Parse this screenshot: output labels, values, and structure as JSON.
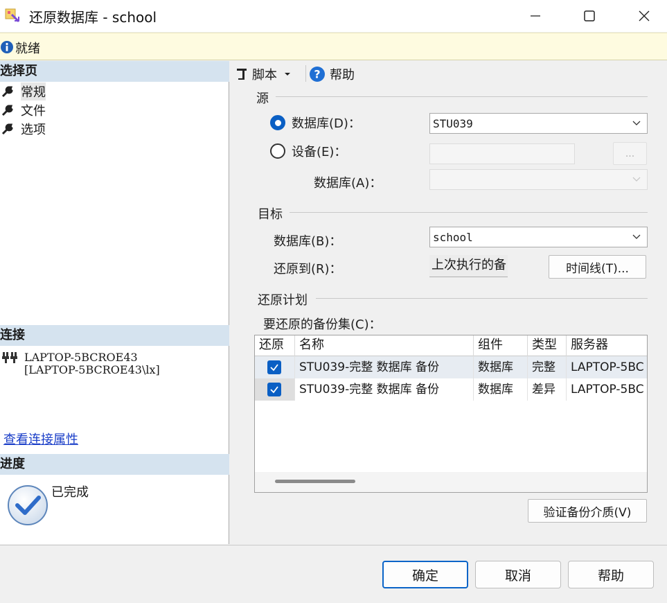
{
  "window": {
    "title": "还原数据库 - school"
  },
  "status": {
    "text": "就绪"
  },
  "left": {
    "select_page_header": "选择页",
    "pages": [
      {
        "label": "常规",
        "icon": "wrench-icon"
      },
      {
        "label": "文件",
        "icon": "wrench-icon"
      },
      {
        "label": "选项",
        "icon": "wrench-icon"
      }
    ],
    "connection_header": "连接",
    "connection_line1": "LAPTOP-5BCROE43",
    "connection_line2": "[LAPTOP-5BCROE43\\lx]",
    "view_connection_link": "查看连接属性",
    "progress_header": "进度",
    "progress_status": "已完成"
  },
  "toolbar": {
    "script_label": "脚本",
    "help_label": "帮助"
  },
  "source": {
    "group_label": "源",
    "database_radio_label": "数据库(D)：",
    "database_value": "STU039",
    "device_radio_label": "设备(E)：",
    "device_browse_label": "...",
    "device_database_label": "数据库(A)："
  },
  "target": {
    "group_label": "目标",
    "database_label": "数据库(B)：",
    "database_value": "school",
    "restore_to_label": "还原到(R)：",
    "restore_to_value": "上次执行的备",
    "timeline_button": "时间线(T)..."
  },
  "plan": {
    "group_label": "还原计划",
    "backup_sets_label": "要还原的备份集(C)：",
    "columns": [
      "还原",
      "名称",
      "组件",
      "类型",
      "服务器"
    ],
    "rows": [
      {
        "restore": true,
        "name": "STU039-完整 数据库 备份",
        "component": "数据库",
        "type": "完整",
        "server": "LAPTOP-5BC"
      },
      {
        "restore": true,
        "name": "STU039-完整 数据库 备份",
        "component": "数据库",
        "type": "差异",
        "server": "LAPTOP-5BC"
      }
    ],
    "verify_button": "验证备份介质(V)"
  },
  "buttons": {
    "ok": "确定",
    "cancel": "取消",
    "help": "帮助"
  },
  "colors": {
    "accent": "#0a5fc4",
    "section_header_bg": "#d5e3ef",
    "status_bg": "#fefbe0",
    "link": "#1a3ec8"
  }
}
